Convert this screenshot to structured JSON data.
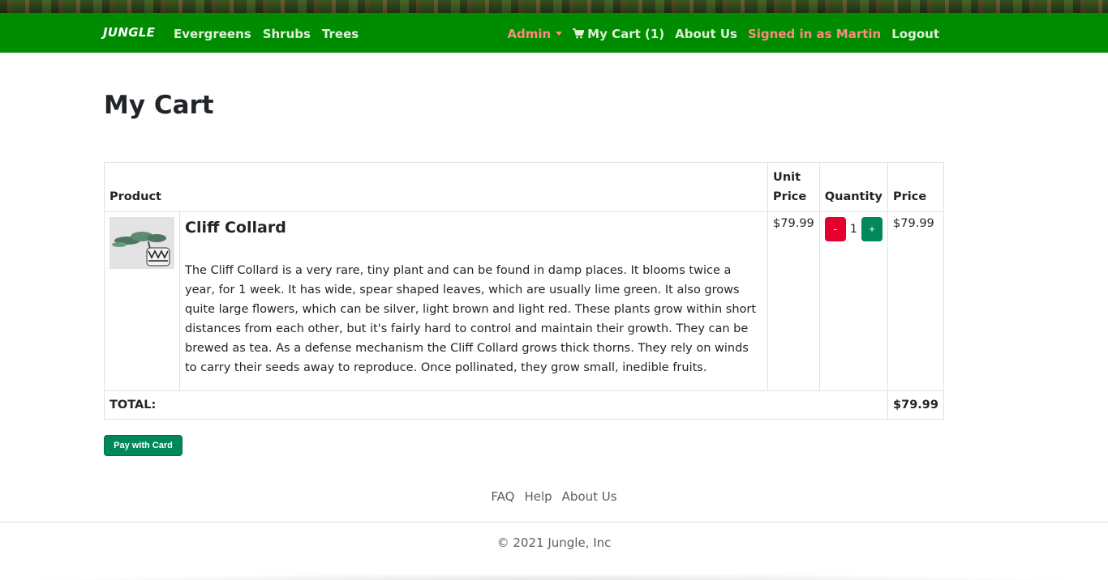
{
  "navbar": {
    "brand": "JUNGLE",
    "left_links": [
      "Evergreens",
      "Shrubs",
      "Trees"
    ],
    "admin_label": "Admin",
    "cart_label": "My Cart (1)",
    "about_label": "About Us",
    "signed_in_label": "Signed in as Martin",
    "logout_label": "Logout",
    "icons": {
      "cart": "cart-icon",
      "admin_dropdown": "caret-down-icon"
    },
    "colors": {
      "bar": "#008c00",
      "link": "#dff0d8",
      "highlight": "#ff8a80"
    }
  },
  "page": {
    "title": "My Cart"
  },
  "table": {
    "headers": {
      "product": "Product",
      "unit_price": "Unit Price",
      "quantity": "Quantity",
      "price": "Price"
    },
    "items": [
      {
        "name": "Cliff Collard",
        "description": "The Cliff Collard is a very rare, tiny plant and can be found in damp places. It blooms twice a year, for 1 week. It has wide, spear shaped leaves, which are usually lime green. It also grows quite large flowers, which can be silver, light brown and light red. These plants grow within short distances from each other, but it's fairly hard to control and maintain their growth. They can be brewed as tea. As a defense mechanism the Cliff Collard grows thick thorns. They rely on winds to carry their seeds away to reproduce. Once pollinated, they grow small, inedible fruits.",
        "unit_price": "$79.99",
        "quantity": "1",
        "price": "$79.99",
        "decrement_label": "-",
        "increment_label": "+"
      }
    ],
    "total_label": "TOTAL:",
    "total_value": "$79.99"
  },
  "checkout": {
    "pay_label": "Pay with Card",
    "color": "#00875a"
  },
  "footer": {
    "links": [
      "FAQ",
      "Help",
      "About Us"
    ],
    "copyright": "© 2021 Jungle, Inc"
  }
}
